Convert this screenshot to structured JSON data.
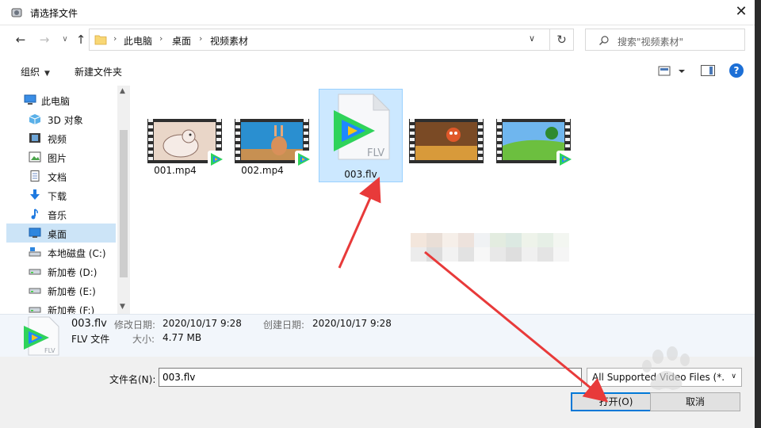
{
  "window": {
    "title": "请选择文件",
    "close_glyph": "✕"
  },
  "nav": {
    "back_glyph": "←",
    "forward_glyph": "→",
    "recent_glyph": "∨",
    "up_glyph": "↑"
  },
  "address": {
    "crumbs": [
      "此电脑",
      "桌面",
      "视频素材"
    ],
    "separator": "›",
    "dropdown_glyph": "∨",
    "refresh_glyph": "↻"
  },
  "search": {
    "placeholder": "搜索\"视频素材\""
  },
  "toolbar": {
    "organize_label": "组织",
    "organize_caret": "▼",
    "new_folder_label": "新建文件夹",
    "help_label": "?"
  },
  "sidebar": {
    "items": [
      {
        "label": "此电脑",
        "icon": "pc-icon"
      },
      {
        "label": "3D 对象",
        "icon": "3d-objects-icon"
      },
      {
        "label": "视频",
        "icon": "videos-icon"
      },
      {
        "label": "图片",
        "icon": "pictures-icon"
      },
      {
        "label": "文档",
        "icon": "documents-icon"
      },
      {
        "label": "下载",
        "icon": "downloads-icon"
      },
      {
        "label": "音乐",
        "icon": "music-icon"
      },
      {
        "label": "桌面",
        "icon": "desktop-icon",
        "selected": true
      },
      {
        "label": "本地磁盘 (C:)",
        "icon": "drive-icon"
      },
      {
        "label": "新加卷 (D:)",
        "icon": "drive-icon"
      },
      {
        "label": "新加卷 (E:)",
        "icon": "drive-icon"
      },
      {
        "label": "新加卷 (F:)",
        "icon": "drive-icon"
      }
    ],
    "scroll_up_glyph": "▲",
    "scroll_down_glyph": "▼"
  },
  "files": [
    {
      "name": "001.mp4",
      "type": "video"
    },
    {
      "name": "002.mp4",
      "type": "video"
    },
    {
      "name": "003.flv",
      "type": "flv",
      "selected": true,
      "ext_text": "FLV"
    },
    {
      "name": "",
      "type": "video"
    },
    {
      "name": "",
      "type": "video"
    }
  ],
  "details": {
    "name": "003.flv",
    "type": "FLV 文件",
    "modified_label": "修改日期:",
    "modified_value": "2020/10/17 9:28",
    "size_label": "大小:",
    "size_value": "4.77 MB",
    "created_label": "创建日期:",
    "created_value": "2020/10/17 9:28",
    "ext_text": "FLV"
  },
  "footer": {
    "filename_label": "文件名(N):",
    "filename_value": "003.flv",
    "filter_value": "All Supported Video Files (*.",
    "filter_caret": "∨",
    "open_label": "打开(O)",
    "cancel_label": "取消"
  },
  "colors": {
    "accent": "#0078d7",
    "selection": "#cce8ff",
    "arrow": "#e83a3a",
    "player_green": "#2fd35a",
    "player_blue": "#1e88ff",
    "player_yellow": "#f5c518"
  }
}
